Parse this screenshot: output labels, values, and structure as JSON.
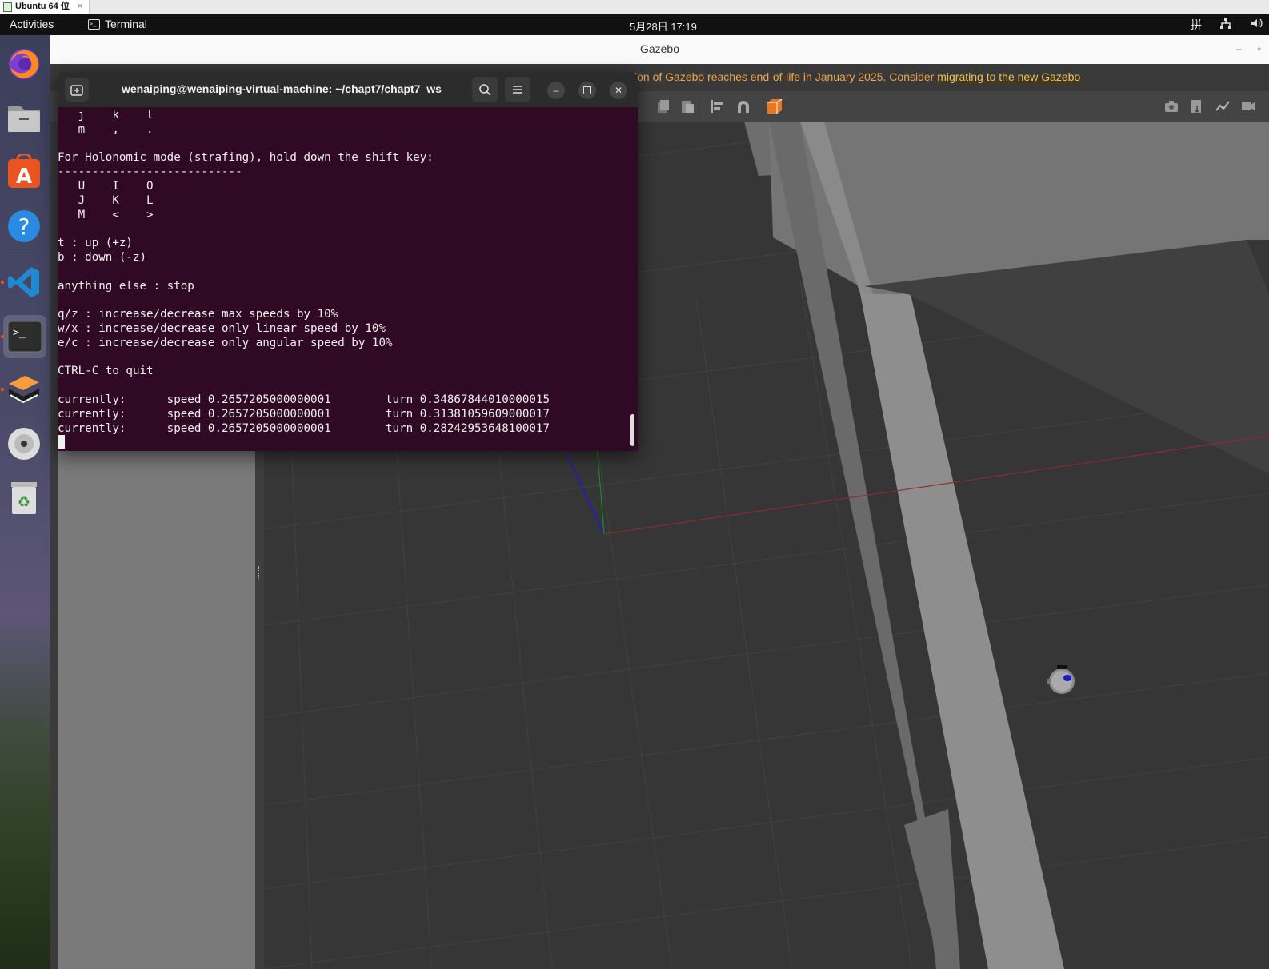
{
  "vm_tab": {
    "title": "Ubuntu 64 位",
    "close": "×"
  },
  "top_panel": {
    "activities": "Activities",
    "app_name": "Terminal",
    "clock": "5月28日  17:19",
    "input_method": "拼",
    "network_icon": "network-icon",
    "volume_icon": "volume-icon"
  },
  "dock": {
    "items": [
      "firefox",
      "files",
      "ubuntu-software",
      "help",
      "vscode",
      "terminal",
      "sublime-merge",
      "dvd",
      "trash"
    ]
  },
  "gazebo": {
    "title": "Gazebo",
    "notice_text": "ion of Gazebo reaches end-of-life in January 2025. Consider ",
    "notice_link": "migrating to the new Gazebo",
    "minimize": "–",
    "maximize": "▫"
  },
  "terminal": {
    "title": "wenaiping@wenaiping-virtual-machine: ~/chapt7/chapt7_ws",
    "minimize": "–",
    "close": "✕",
    "lines": [
      "   j    k    l",
      "   m    ,    .",
      "",
      "For Holonomic mode (strafing), hold down the shift key:",
      "---------------------------",
      "   U    I    O",
      "   J    K    L",
      "   M    <    >",
      "",
      "t : up (+z)",
      "b : down (-z)",
      "",
      "anything else : stop",
      "",
      "q/z : increase/decrease max speeds by 10%",
      "w/x : increase/decrease only linear speed by 10%",
      "e/c : increase/decrease only angular speed by 10%",
      "",
      "CTRL-C to quit",
      "",
      "currently:      speed 0.2657205000000001        turn 0.34867844010000015",
      "currently:      speed 0.2657205000000001        turn 0.31381059609000017",
      "currently:      speed 0.2657205000000001        turn 0.28242953648100017"
    ]
  }
}
